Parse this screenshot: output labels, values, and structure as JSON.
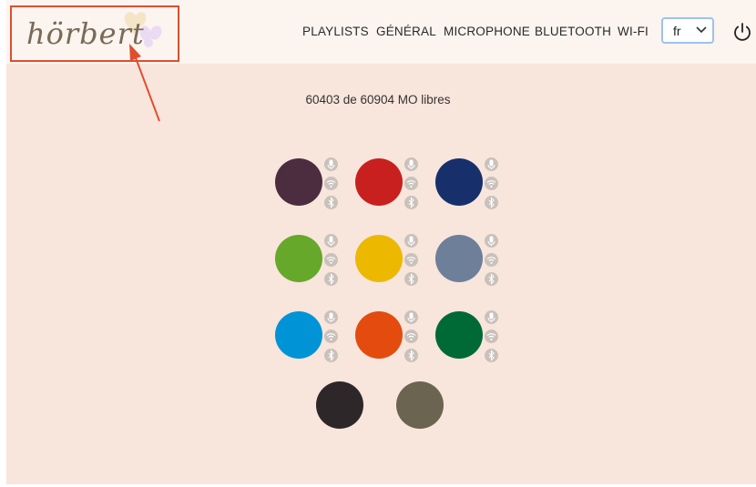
{
  "header": {
    "logo_text": "hörbert",
    "nav": [
      "PLAYLISTS",
      "GÉNÉRAL",
      "MICROPHONE",
      "BLUETOOTH",
      "WI-FI"
    ],
    "language": "fr"
  },
  "storage_text": "60403 de 60904 MO libres",
  "playlists": [
    {
      "color": "#4b2d3f",
      "status_icons": [
        "microphone-icon",
        "wifi-icon",
        "bluetooth-icon"
      ]
    },
    {
      "color": "#c8201e",
      "status_icons": [
        "microphone-icon",
        "wifi-icon",
        "bluetooth-icon"
      ]
    },
    {
      "color": "#17306c",
      "status_icons": [
        "microphone-icon",
        "wifi-icon",
        "bluetooth-icon"
      ]
    },
    {
      "color": "#66a82a",
      "status_icons": [
        "microphone-icon",
        "wifi-icon",
        "bluetooth-icon"
      ]
    },
    {
      "color": "#ecb800",
      "status_icons": [
        "microphone-icon",
        "wifi-icon",
        "bluetooth-icon"
      ]
    },
    {
      "color": "#6d7f99",
      "status_icons": [
        "microphone-icon",
        "wifi-icon",
        "bluetooth-icon"
      ]
    },
    {
      "color": "#0094d6",
      "status_icons": [
        "microphone-icon",
        "wifi-icon",
        "bluetooth-icon"
      ]
    },
    {
      "color": "#e44c0f",
      "status_icons": [
        "microphone-icon",
        "wifi-icon",
        "bluetooth-icon"
      ]
    },
    {
      "color": "#006a36",
      "status_icons": [
        "microphone-icon",
        "wifi-icon",
        "bluetooth-icon"
      ]
    },
    {
      "color": "#2d2729",
      "status_icons": []
    },
    {
      "color": "#6b6450",
      "status_icons": []
    }
  ],
  "annotation": {
    "color": "#e04e2e"
  }
}
